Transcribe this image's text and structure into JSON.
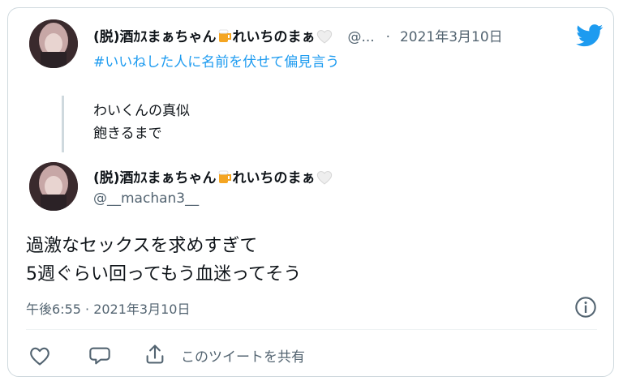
{
  "parent_tweet": {
    "display_name": "(脱)酒カスまぁちゃん🍺れいちの まぁ🤍",
    "display_name_text": "(脱)酒ｶｽまぁちゃん",
    "display_name_text2": "れいちのまぁ",
    "handle_truncated": "@...",
    "separator": "·",
    "date": "2021年3月10日",
    "hashtag": "#いいねした人に名前を伏せて偏見言う",
    "body_lines": [
      "わいくんの真似",
      "飽きるまで"
    ]
  },
  "main_tweet": {
    "display_name_text": "(脱)酒ｶｽまぁちゃん",
    "display_name_text2": "れいちのまぁ",
    "handle": "@__machan3__",
    "body_lines": [
      "過激なセックスを求めすぎて",
      "5週ぐらい回ってもう血迷ってそう"
    ],
    "timestamp": "午後6:55 · 2021年3月10日"
  },
  "actions": {
    "share_label": "このツイートを共有"
  },
  "icons": {
    "brand": "twitter-bird-icon",
    "info": "info-icon",
    "like": "heart-icon",
    "reply": "reply-icon",
    "share": "share-icon"
  },
  "colors": {
    "brand": "#1d9bf0",
    "muted": "#536471",
    "border": "#cfd9de"
  }
}
